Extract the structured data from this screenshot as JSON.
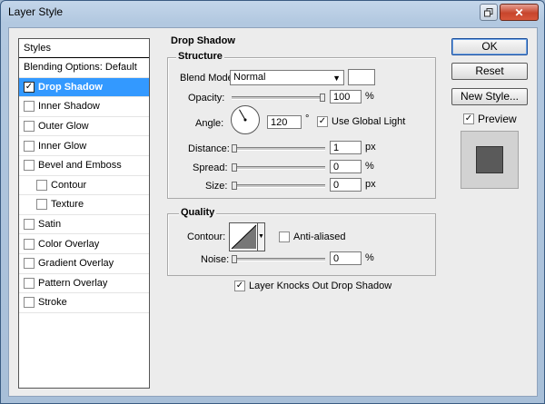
{
  "window": {
    "title": "Layer Style"
  },
  "styles_list": {
    "header": "Styles",
    "blending_options": "Blending Options: Default",
    "items": [
      {
        "label": "Drop Shadow",
        "checked": true,
        "selected": true,
        "indent": false
      },
      {
        "label": "Inner Shadow",
        "checked": false,
        "selected": false,
        "indent": false
      },
      {
        "label": "Outer Glow",
        "checked": false,
        "selected": false,
        "indent": false
      },
      {
        "label": "Inner Glow",
        "checked": false,
        "selected": false,
        "indent": false
      },
      {
        "label": "Bevel and Emboss",
        "checked": false,
        "selected": false,
        "indent": false
      },
      {
        "label": "Contour",
        "checked": false,
        "selected": false,
        "indent": true
      },
      {
        "label": "Texture",
        "checked": false,
        "selected": false,
        "indent": true
      },
      {
        "label": "Satin",
        "checked": false,
        "selected": false,
        "indent": false
      },
      {
        "label": "Color Overlay",
        "checked": false,
        "selected": false,
        "indent": false
      },
      {
        "label": "Gradient Overlay",
        "checked": false,
        "selected": false,
        "indent": false
      },
      {
        "label": "Pattern Overlay",
        "checked": false,
        "selected": false,
        "indent": false
      },
      {
        "label": "Stroke",
        "checked": false,
        "selected": false,
        "indent": false
      }
    ]
  },
  "drop_shadow": {
    "title": "Drop Shadow",
    "structure": {
      "title": "Structure",
      "blend_mode_label": "Blend Mode:",
      "blend_mode_value": "Normal",
      "opacity_label": "Opacity:",
      "opacity_value": "100",
      "opacity_level": 1.0,
      "angle_label": "Angle:",
      "angle_value": "120",
      "angle_unit": "°",
      "use_global_light_label": "Use Global Light",
      "use_global_light_checked": true,
      "distance_label": "Distance:",
      "distance_value": "1",
      "distance_level": 0.0,
      "spread_label": "Spread:",
      "spread_value": "0",
      "spread_level": 0.0,
      "size_label": "Size:",
      "size_value": "0",
      "size_level": 0.0,
      "unit_px": "px",
      "unit_percent": "%"
    },
    "quality": {
      "title": "Quality",
      "contour_label": "Contour:",
      "anti_aliased_label": "Anti-aliased",
      "anti_aliased_checked": false,
      "noise_label": "Noise:",
      "noise_value": "0",
      "noise_level": 0.0
    },
    "knocks_out_label": "Layer Knocks Out Drop Shadow",
    "knocks_out_checked": true
  },
  "buttons": {
    "ok": "OK",
    "reset": "Reset",
    "new_style": "New Style...",
    "preview_label": "Preview",
    "preview_checked": true
  },
  "colors": {
    "selection": "#3399ff",
    "panel_bg": "#ececec",
    "shadow_color": "#ffffff",
    "preview_swatch": "#5a5a5a"
  }
}
